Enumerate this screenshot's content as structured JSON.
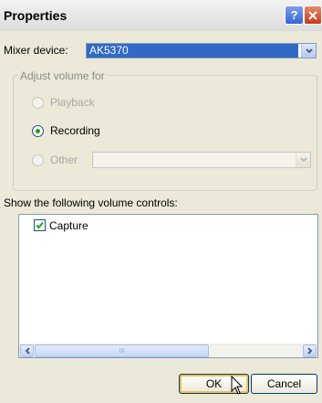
{
  "window": {
    "title": "Properties",
    "help_button": "?"
  },
  "mixer": {
    "label": "Mixer device:",
    "value": "AK5370"
  },
  "adjust_volume": {
    "legend": "Adjust volume for",
    "options": [
      {
        "label": "Playback",
        "selected": false,
        "enabled": false
      },
      {
        "label": "Recording",
        "selected": true,
        "enabled": true
      },
      {
        "label": "Other",
        "selected": false,
        "enabled": false
      }
    ],
    "other_value": ""
  },
  "controls": {
    "label": "Show the following volume controls:",
    "items": [
      {
        "label": "Capture",
        "checked": true
      }
    ],
    "scroll_thumb_glyph": "III"
  },
  "buttons": {
    "ok": "OK",
    "cancel": "Cancel"
  },
  "colors": {
    "selection": "#316ac5",
    "radio_selected": "#21a121",
    "checkmark": "#21a121"
  }
}
